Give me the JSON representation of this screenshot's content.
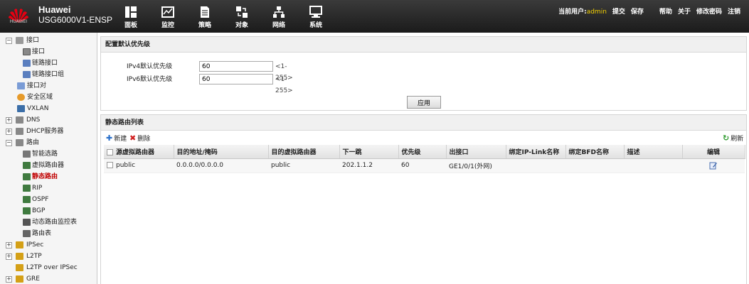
{
  "header": {
    "logo_text": "HUAWEI",
    "brand_line1": "Huawei",
    "brand_line2": "USG6000V1-ENSP",
    "nav": [
      {
        "label": "面板"
      },
      {
        "label": "监控"
      },
      {
        "label": "策略"
      },
      {
        "label": "对象"
      },
      {
        "label": "网络"
      },
      {
        "label": "系统"
      }
    ],
    "current_user_label": "当前用户:",
    "current_user": "admin",
    "links": {
      "submit": "提交",
      "save": "保存",
      "help": "帮助",
      "about": "关于",
      "change_password": "修改密码",
      "logout": "注销"
    }
  },
  "sidebar": {
    "items": [
      {
        "label": "接口",
        "toggle": "−"
      },
      {
        "label": "接口"
      },
      {
        "label": "链路接口"
      },
      {
        "label": "链路接口组"
      },
      {
        "label": "接口对"
      },
      {
        "label": "安全区域"
      },
      {
        "label": "VXLAN"
      },
      {
        "label": "DNS",
        "toggle": "+"
      },
      {
        "label": "DHCP服务器",
        "toggle": "+"
      },
      {
        "label": "路由",
        "toggle": "−"
      },
      {
        "label": "智能选路"
      },
      {
        "label": "虚拟路由器"
      },
      {
        "label": "静态路由"
      },
      {
        "label": "RIP"
      },
      {
        "label": "OSPF"
      },
      {
        "label": "BGP"
      },
      {
        "label": "动态路由监控表"
      },
      {
        "label": "路由表"
      },
      {
        "label": "IPSec",
        "toggle": "+"
      },
      {
        "label": "L2TP",
        "toggle": "+"
      },
      {
        "label": "L2TP over IPSec"
      },
      {
        "label": "GRE",
        "toggle": "+"
      }
    ]
  },
  "priority": {
    "title": "配置默认优先级",
    "ipv4_label": "IPv4默认优先级",
    "ipv4_value": "60",
    "ipv4_range": "<1-255>",
    "ipv6_label": "IPv6默认优先级",
    "ipv6_value": "60",
    "ipv6_range": "<1-255>",
    "apply_label": "应用"
  },
  "routes": {
    "title": "静态路由列表",
    "new_label": "新建",
    "delete_label": "删除",
    "refresh_label": "刷新",
    "columns": [
      "源虚拟路由器",
      "目的地址/掩码",
      "目的虚拟路由器",
      "下一跳",
      "优先级",
      "出接口",
      "绑定IP-Link名称",
      "绑定BFD名称",
      "描述",
      "编辑"
    ],
    "rows": [
      {
        "src_vr": "public",
        "dest": "0.0.0.0/0.0.0.0",
        "dest_vr": "public",
        "next_hop": "202.1.1.2",
        "priority": "60",
        "out_if": "GE1/0/1(外网)",
        "ip_link": "",
        "bfd": "",
        "desc": ""
      }
    ]
  },
  "colors": {
    "header_bg": "#1b1b1b",
    "user": "#f3d000",
    "selected": "#c00000"
  }
}
